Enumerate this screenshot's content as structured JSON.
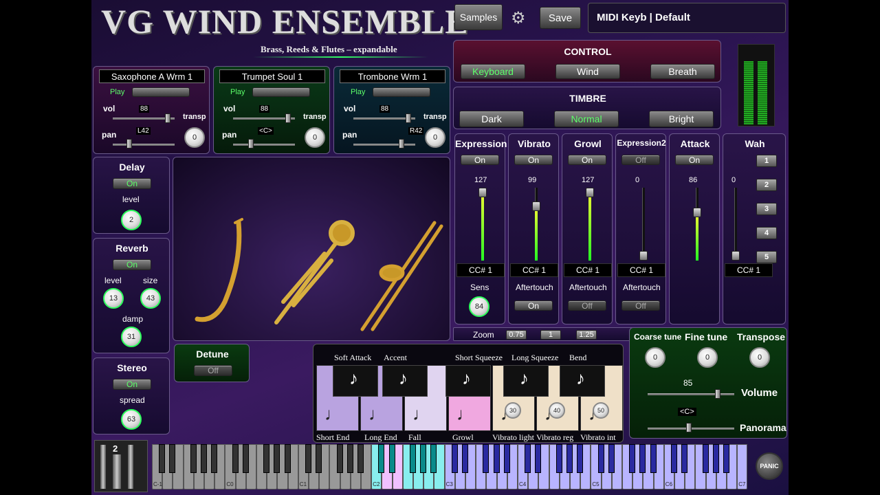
{
  "header": {
    "title": "VG WIND ENSEMBLE",
    "subtitle": "Brass, Reeds & Flutes – expandable",
    "samples": "Samples",
    "save": "Save",
    "midi": "MIDI Keyb | Default"
  },
  "control": {
    "title": "CONTROL",
    "keyboard": "Keyboard",
    "wind": "Wind",
    "breath": "Breath"
  },
  "timbre": {
    "title": "TIMBRE",
    "dark": "Dark",
    "normal": "Normal",
    "bright": "Bright"
  },
  "instruments": [
    {
      "name": "Saxophone A Wrm 1",
      "play": "Play",
      "vol_label": "vol",
      "vol": "88",
      "pan_label": "pan",
      "pan": "L42",
      "transp_label": "transp",
      "transp": "0"
    },
    {
      "name": "Trumpet Soul 1",
      "play": "Play",
      "vol_label": "vol",
      "vol": "88",
      "pan_label": "pan",
      "pan": "<C>",
      "transp_label": "transp",
      "transp": "0"
    },
    {
      "name": "Trombone Wrm 1",
      "play": "Play",
      "vol_label": "vol",
      "vol": "88",
      "pan_label": "pan",
      "pan": "R42",
      "transp_label": "transp",
      "transp": "0"
    }
  ],
  "delay": {
    "title": "Delay",
    "on": "On",
    "level_label": "level",
    "level": "2"
  },
  "reverb": {
    "title": "Reverb",
    "on": "On",
    "level_label": "level",
    "level": "13",
    "size_label": "size",
    "size": "43",
    "damp_label": "damp",
    "damp": "31"
  },
  "stereo": {
    "title": "Stereo",
    "on": "On",
    "spread_label": "spread",
    "spread": "63"
  },
  "detune": {
    "title": "Detune",
    "state": "Off"
  },
  "mod": [
    {
      "title": "Expression",
      "state": "On",
      "value": "127",
      "cc": "CC# 1",
      "sub": "Sens",
      "subval": "84"
    },
    {
      "title": "Vibrato",
      "state": "On",
      "value": "99",
      "cc": "CC# 1",
      "sub": "Aftertouch",
      "substate": "On"
    },
    {
      "title": "Growl",
      "state": "On",
      "value": "127",
      "cc": "CC# 1",
      "sub": "Aftertouch",
      "substate": "Off"
    },
    {
      "title": "Expression2",
      "state": "Off",
      "value": "0",
      "cc": "CC# 1",
      "sub": "Aftertouch",
      "substate": "Off"
    },
    {
      "title": "Attack",
      "state": "On",
      "value": "86"
    },
    {
      "title": "Wah",
      "value": "0",
      "cc": "CC# 1",
      "presets": [
        "1",
        "2",
        "3",
        "4",
        "5"
      ]
    }
  ],
  "zoom": {
    "label": "Zoom",
    "opts": [
      "0.75",
      "1",
      "1.25"
    ]
  },
  "tune": {
    "coarse": "Coarse tune",
    "coarse_val": "0",
    "fine": "Fine tune",
    "fine_val": "0",
    "transpose": "Transpose",
    "transpose_val": "0",
    "volume_val": "85",
    "volume": "Volume",
    "pan_val": "<C>",
    "panorama": "Panorama"
  },
  "artic": {
    "top": [
      "Soft Attack",
      "Accent",
      "Short Squeeze",
      "Long Squeeze",
      "Bend"
    ],
    "bottom": [
      "Short End",
      "Long End",
      "Fall",
      "Growl",
      "Vibrato light",
      "Vibrato reg",
      "Vibrato int"
    ],
    "vib_vals": [
      "30",
      "40",
      "50"
    ]
  },
  "kbd": {
    "octave": "2",
    "panic": "PANIC",
    "octaves": [
      "C-1",
      "C0",
      "C1",
      "C2",
      "C3",
      "C4",
      "C5",
      "C6",
      "C7"
    ]
  },
  "colors": {
    "accent": "#2aff5a",
    "bg": "#2a1450"
  }
}
